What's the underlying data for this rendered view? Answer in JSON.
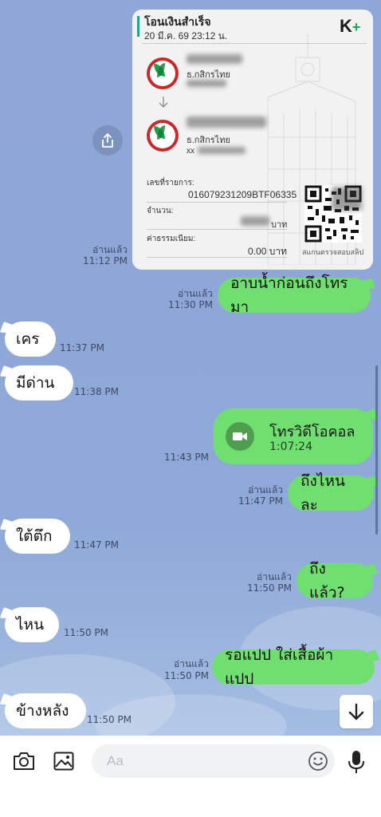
{
  "receipt": {
    "title": "โอนเงินสำเร็จ",
    "datetime": "20 มี.ค. 69  23:12 น.",
    "brand": "K+",
    "from_bank": "ธ.กสิกรไทย",
    "to_bank": "ธ.กสิกรไทย",
    "to_account_prefix": "xx",
    "ref_label": "เลขที่รายการ:",
    "ref_value": "016079231209BTF06335",
    "amount_label": "จำนวน:",
    "amount_unit": "บาท",
    "fee_label": "ค่าธรรมเนียม:",
    "fee_value": "0.00 บาท",
    "qr_caption": "สแกนตรวจสอบสลิป",
    "read": "อ่านแล้ว",
    "time": "11:12 PM"
  },
  "messages": [
    {
      "side": "out",
      "text": "อาบน้ำก่อนถึงโทรมา",
      "read": "อ่านแล้ว",
      "time": "11:30 PM"
    },
    {
      "side": "in",
      "text": "เคร",
      "time": "11:37 PM"
    },
    {
      "side": "in",
      "text": "มีด่าน",
      "time": "11:38 PM"
    },
    {
      "side": "out",
      "type": "call",
      "title": "โทรวิดีโอคอล",
      "duration": "1:07:24",
      "time": "11:43 PM"
    },
    {
      "side": "out",
      "text": "ถึงไหนละ",
      "read": "อ่านแล้ว",
      "time": "11:47 PM"
    },
    {
      "side": "in",
      "text": "ใต้ตึก",
      "time": "11:47 PM"
    },
    {
      "side": "out",
      "text": "ถึงแล้ว?",
      "read": "อ่านแล้ว",
      "time": "11:50 PM"
    },
    {
      "side": "in",
      "text": "ไหน",
      "time": "11:50 PM"
    },
    {
      "side": "out",
      "text": "รอแปป ใส่เสื้อผ้าแปป",
      "read": "อ่านแล้ว",
      "time": "11:50 PM"
    },
    {
      "side": "in",
      "text": "ข้างหลัง",
      "time": "11:50 PM"
    }
  ],
  "composer": {
    "placeholder": "Aa"
  },
  "icons": {
    "share": "share-icon",
    "scroll": "arrow-down-icon",
    "camera": "camera-icon",
    "gallery": "image-icon",
    "emoji": "emoji-icon",
    "mic": "microphone-icon",
    "video": "video-camera-icon"
  },
  "colors": {
    "outgoing": "#6fe06f",
    "incoming": "#ffffff",
    "background": "#8fa6d6"
  }
}
